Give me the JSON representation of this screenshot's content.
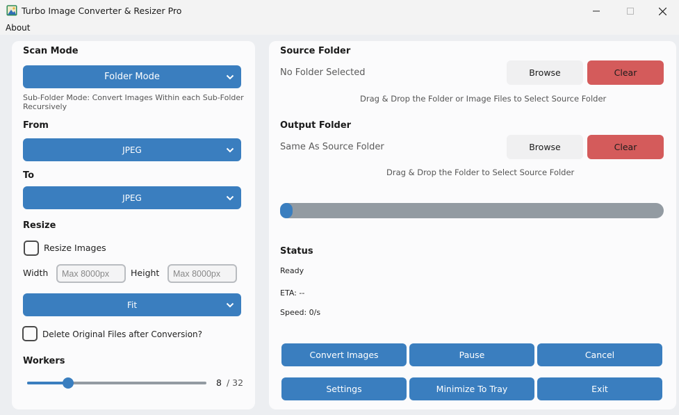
{
  "window": {
    "title": "Turbo Image Converter & Resizer Pro"
  },
  "menu": {
    "about": "About"
  },
  "left": {
    "scan_mode": {
      "heading": "Scan Mode",
      "selected": "Folder Mode",
      "description": "Sub-Folder Mode: Convert Images Within each Sub-Folder Recursively"
    },
    "from": {
      "heading": "From",
      "selected": "JPEG"
    },
    "to": {
      "heading": "To",
      "selected": "JPEG"
    },
    "resize": {
      "heading": "Resize",
      "checkbox_label": "Resize Images",
      "checked": false,
      "width_label": "Width",
      "width_placeholder": "Max 8000px",
      "height_label": "Height",
      "height_placeholder": "Max 8000px",
      "mode_selected": "Fit"
    },
    "delete_originals": {
      "label": "Delete Original Files after Conversion?",
      "checked": false
    },
    "workers": {
      "heading": "Workers",
      "value": "8",
      "max": "/ 32",
      "fraction": 0.23
    }
  },
  "right": {
    "source": {
      "heading": "Source Folder",
      "value": "No Folder Selected",
      "browse": "Browse",
      "clear": "Clear",
      "hint": "Drag & Drop the Folder or Image Files to Select Source Folder"
    },
    "output": {
      "heading": "Output Folder",
      "value": "Same As Source Folder",
      "browse": "Browse",
      "clear": "Clear",
      "hint": "Drag & Drop the Folder to Select Source Folder"
    },
    "progress": {
      "percent": 0
    },
    "status": {
      "heading": "Status",
      "state": "Ready",
      "eta": "ETA: --",
      "speed": "Speed: 0/s"
    },
    "actions": {
      "convert": "Convert Images",
      "pause": "Pause",
      "cancel": "Cancel",
      "settings": "Settings",
      "minimize": "Minimize To Tray",
      "exit": "Exit"
    }
  },
  "colors": {
    "accent": "#3a7ebf",
    "danger": "#d45b5b",
    "track": "#939ba2"
  }
}
